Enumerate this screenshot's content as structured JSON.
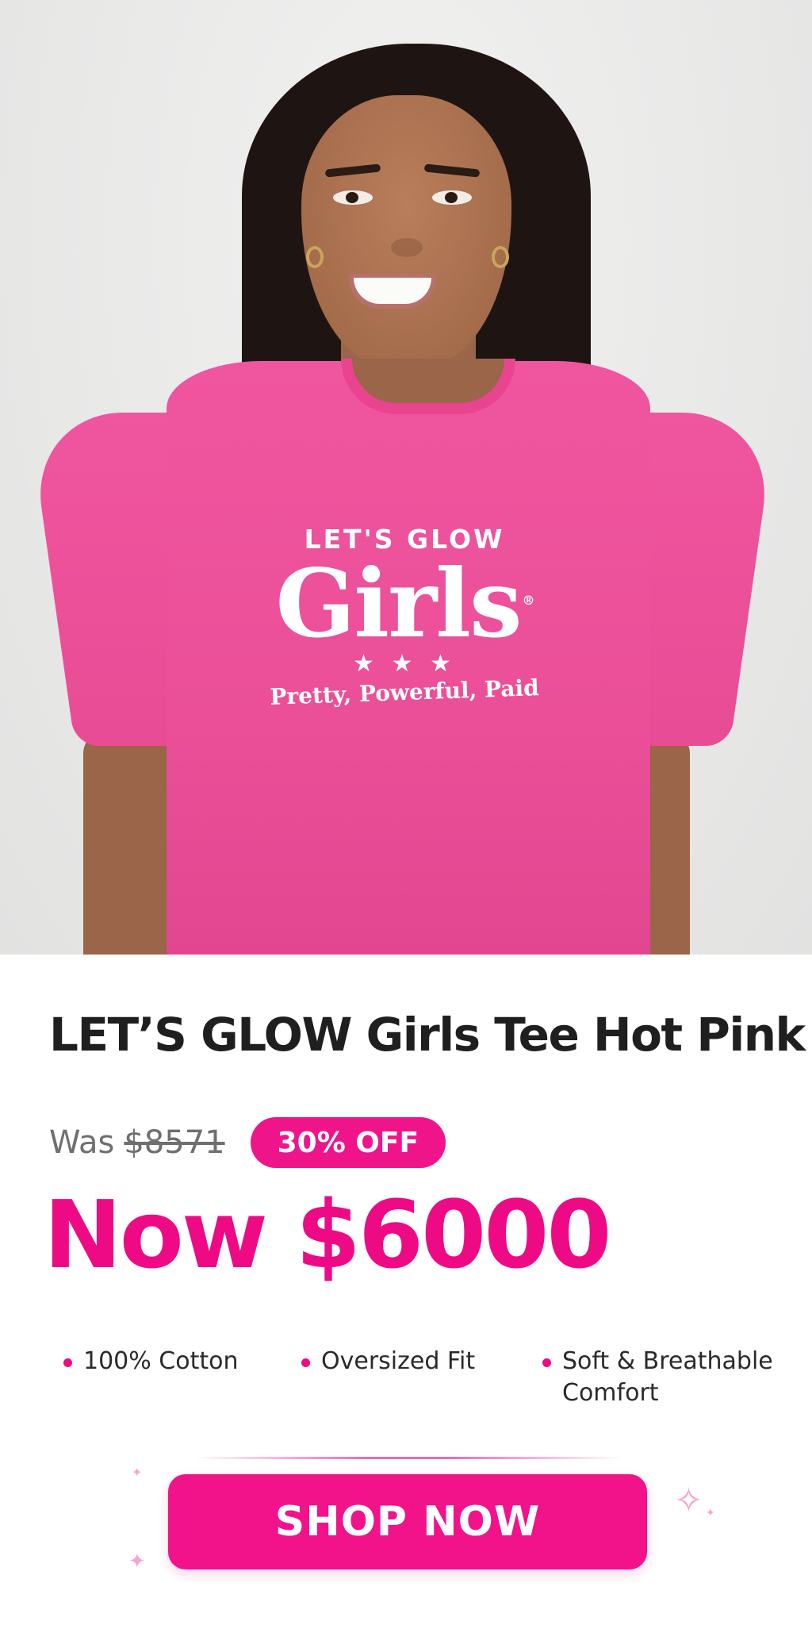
{
  "hero": {
    "image_alt": "Smiling woman wearing a hot pink oversized t-shirt",
    "print": {
      "top": "LET'S GLOW",
      "main": "Girls",
      "registered": "®",
      "ornament": "★ ★ ★",
      "tagline": "Pretty, Powerful, Paid"
    }
  },
  "product": {
    "title": "LET’S GLOW Girls Tee Hot Pink",
    "was_label": "Was",
    "was_price": "$8571",
    "discount_badge": "30% OFF",
    "now_price": "Now $6000"
  },
  "features": [
    {
      "text": "100% Cotton"
    },
    {
      "text": "Oversized Fit"
    },
    {
      "text": "Soft & Breathable Comfort"
    }
  ],
  "cta": {
    "label": "SHOP NOW"
  },
  "colors": {
    "accent": "#EE0A85",
    "shirt": "#EC4F99",
    "title_text": "#1F1F1F",
    "muted_text": "#6F6F6F"
  },
  "icons": {
    "bullet": "dot-icon",
    "decoration": "sparkle-icon"
  }
}
